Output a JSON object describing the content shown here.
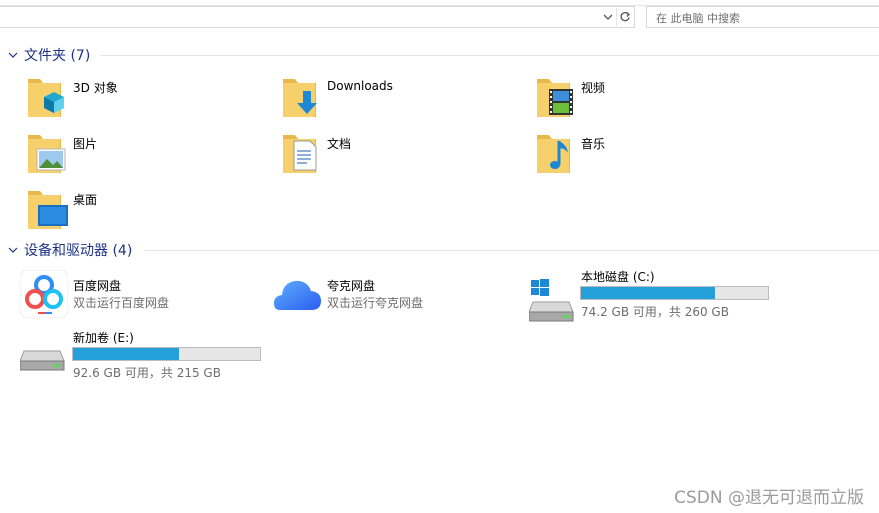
{
  "address": {
    "refresh_icon": "refresh-icon"
  },
  "search": {
    "placeholder": "在 此电脑 中搜索"
  },
  "groups": [
    {
      "title": "文件夹 (7)",
      "items": [
        {
          "label": "3D 对象",
          "icon": "3d-objects-folder-icon"
        },
        {
          "label": "Downloads",
          "icon": "downloads-folder-icon"
        },
        {
          "label": "视频",
          "icon": "videos-folder-icon"
        },
        {
          "label": "图片",
          "icon": "pictures-folder-icon"
        },
        {
          "label": "文档",
          "icon": "documents-folder-icon"
        },
        {
          "label": "音乐",
          "icon": "music-folder-icon"
        },
        {
          "label": "桌面",
          "icon": "desktop-folder-icon"
        }
      ]
    },
    {
      "title": "设备和驱动器 (4)",
      "items": [
        {
          "label": "百度网盘",
          "sub": "双击运行百度网盘",
          "icon": "baidu-netdisk-icon"
        },
        {
          "label": "夸克网盘",
          "sub": "双击运行夸克网盘",
          "icon": "quark-netdisk-icon"
        },
        {
          "label": "本地磁盘 (C:)",
          "sub": "74.2 GB 可用，共 260 GB",
          "icon": "windows-drive-icon",
          "used_fraction": 0.715
        },
        {
          "label": "新加卷 (E:)",
          "sub": "92.6 GB 可用，共 215 GB",
          "icon": "drive-icon",
          "used_fraction": 0.569
        }
      ]
    }
  ],
  "colors": {
    "accent": "#26a0da",
    "header": "#1e3287",
    "folder": "#f6d16b"
  },
  "watermark": "CSDN @退无可退而立版"
}
